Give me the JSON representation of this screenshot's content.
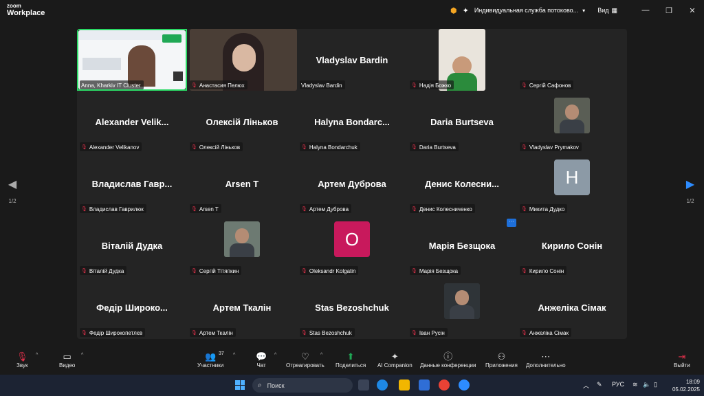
{
  "titlebar": {
    "logo_line1": "zoom",
    "logo_line2": "Workplace",
    "service_label": "Индивидуальная служба потоково...",
    "view_label": "Вид",
    "security_icon": "shield-icon",
    "spark_icon": "ai-sparkle-icon"
  },
  "gallery": {
    "page_left": "1/2",
    "page_right": "1/2",
    "tiles": [
      {
        "big": "",
        "caption": "Anna, Kharkiv IT Cluster",
        "type": "share",
        "mic_muted": false
      },
      {
        "big": "",
        "caption": "Анастасия Пелюх",
        "type": "video",
        "mic_muted": true
      },
      {
        "big": "Vladyslav Bardin",
        "caption": "Vladyslav Bardin",
        "type": "name",
        "mic_muted": false
      },
      {
        "big": "",
        "caption": "Надія Божко",
        "type": "video",
        "mic_muted": true
      },
      {
        "big": "",
        "caption": "Сергій Сафонов",
        "type": "blank",
        "mic_muted": true
      },
      {
        "big": "Alexander Velik...",
        "caption": "Alexander Velikanov",
        "type": "name",
        "mic_muted": true
      },
      {
        "big": "Олексій Ліньков",
        "caption": "Олексій Ліньков",
        "type": "name",
        "mic_muted": true
      },
      {
        "big": "Halyna Bondarc...",
        "caption": "Halyna Bondarchuk",
        "type": "name",
        "mic_muted": true
      },
      {
        "big": "Daria Burtseva",
        "caption": "Daria Burtseva",
        "type": "name",
        "mic_muted": true
      },
      {
        "big": "",
        "caption": "Vladyslav Prymakov",
        "type": "photo",
        "mic_muted": true
      },
      {
        "big": "Владислав Гавр...",
        "caption": "Владислав Гаврилюк",
        "type": "name",
        "mic_muted": true
      },
      {
        "big": "Arsen T",
        "caption": "Arsen T",
        "type": "name",
        "mic_muted": true
      },
      {
        "big": "Артем Дуброва",
        "caption": "Артем Дуброва",
        "type": "name",
        "mic_muted": true
      },
      {
        "big": "Денис Колесни...",
        "caption": "Денис Колесниченко",
        "type": "name",
        "mic_muted": true
      },
      {
        "big": "",
        "caption": "Микита Дудко",
        "type": "avatar",
        "letter": "Н",
        "color": "#8c9aa6",
        "mic_muted": true
      },
      {
        "big": "Віталій Дудка",
        "caption": "Віталій Дудка",
        "type": "name",
        "mic_muted": true
      },
      {
        "big": "",
        "caption": "Сергій Тітяпкин",
        "type": "photo",
        "mic_muted": true
      },
      {
        "big": "",
        "caption": "Oleksandr Kolgatin",
        "type": "avatar",
        "letter": "O",
        "color": "#c8195c",
        "mic_muted": true
      },
      {
        "big": "Марія Безщока",
        "caption": "Марія Безщока",
        "type": "name",
        "mic_muted": true
      },
      {
        "big": "Кирило Сонін",
        "caption": "Кирило Сонін",
        "type": "name",
        "mic_muted": true
      },
      {
        "big": "Федір Широко...",
        "caption": "Федір Широкопетлєв",
        "type": "name",
        "mic_muted": true
      },
      {
        "big": "Артем Ткалін",
        "caption": "Артем Ткалін",
        "type": "name",
        "mic_muted": true
      },
      {
        "big": "Stas Bezoshchuk",
        "caption": "Stas Bezoshchuk",
        "type": "name",
        "mic_muted": true
      },
      {
        "big": "",
        "caption": "Іван Русін",
        "type": "photo",
        "mic_muted": true
      },
      {
        "big": "Анжеліка Сімак",
        "caption": "Анжеліка Сімак",
        "type": "name",
        "mic_muted": true
      }
    ]
  },
  "toolbar": {
    "audio": "Звук",
    "video": "Видео",
    "participants": "Участники",
    "participants_count": "37",
    "chat": "Чат",
    "react": "Отреагировать",
    "share": "Поделиться",
    "ai": "AI Companion",
    "info": "Данные конференции",
    "apps": "Приложения",
    "more": "Дополнительно",
    "leave": "Выйти"
  },
  "taskbar": {
    "search_placeholder": "Поиск",
    "lang": "РУС",
    "time": "18:09",
    "date": "05.02.2025"
  },
  "colors": {
    "active_speaker": "#2bd965",
    "muted_mic": "#e0304a",
    "share_green": "#1fa855"
  }
}
